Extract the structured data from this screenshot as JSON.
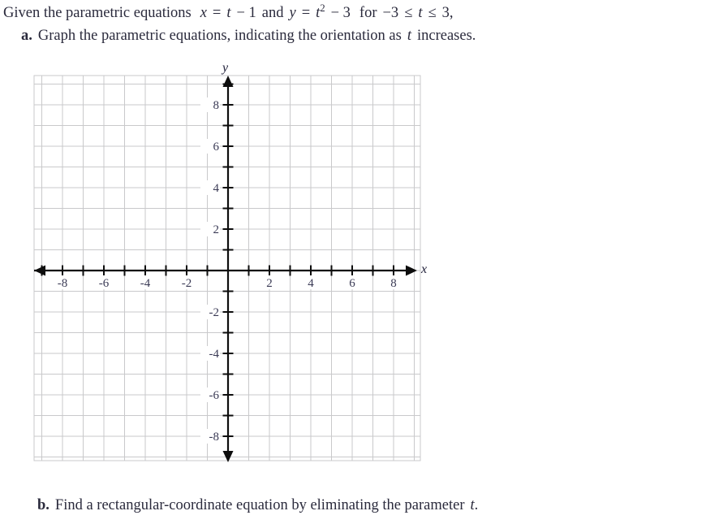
{
  "problem": {
    "stem": {
      "pre": "Given the parametric equations",
      "eq_x_lhs": "x",
      "eq_x_eq": "=",
      "eq_x_rhs_t": "t",
      "eq_x_rhs_rest": "− 1",
      "and": "and",
      "eq_y_lhs": "y",
      "eq_y_eq": "=",
      "eq_y_rhs_t": "t",
      "eq_y_exp": "2",
      "eq_y_rest": "− 3",
      "for": "for",
      "domain_lo": "−3",
      "domain_rel1": "≤",
      "domain_var": "t",
      "domain_rel2": "≤",
      "domain_hi": "3,"
    },
    "part_a": {
      "label": "a.",
      "text_before_var": "Graph the parametric equations, indicating the orientation as",
      "var": "t",
      "text_after_var": "increases."
    },
    "part_b": {
      "label": "b.",
      "text_before_var": "Find a rectangular-coordinate equation by eliminating the parameter",
      "var": "t",
      "text_after_var": "."
    }
  },
  "graph": {
    "x_axis_label": "x",
    "y_axis_label": "y",
    "x_tick_labels": [
      "-8",
      "-6",
      "-4",
      "-2",
      "2",
      "4",
      "6",
      "8"
    ],
    "x_tick_values": [
      -8,
      -6,
      -4,
      -2,
      2,
      4,
      6,
      8
    ],
    "y_tick_labels": [
      "8",
      "6",
      "4",
      "2",
      "-2",
      "-4",
      "-6",
      "-8"
    ],
    "y_tick_values": [
      8,
      6,
      4,
      2,
      -2,
      -4,
      -6,
      -8
    ],
    "grid_color": "#c9c9cb",
    "axis_color": "#0d0d0d",
    "label_color": "#3a3a55",
    "background": "#ffffff"
  },
  "chart_data": {
    "type": "scatter",
    "title": "",
    "xlabel": "x",
    "ylabel": "y",
    "xlim": [
      -9.4,
      9.3
    ],
    "ylim": [
      -9.3,
      9.3
    ],
    "xticks": [
      -8,
      -6,
      -4,
      -2,
      2,
      4,
      6,
      8
    ],
    "yticks": [
      8,
      6,
      4,
      2,
      -2,
      -4,
      -6,
      -8
    ],
    "minor_tick_step": 1,
    "grid": true,
    "grid_step": 1,
    "legend": "none",
    "series": [],
    "annotations": [],
    "note": "Empty coordinate grid provided for the student to plot x = t - 1, y = t^2 - 3 for -3 <= t <= 3"
  }
}
